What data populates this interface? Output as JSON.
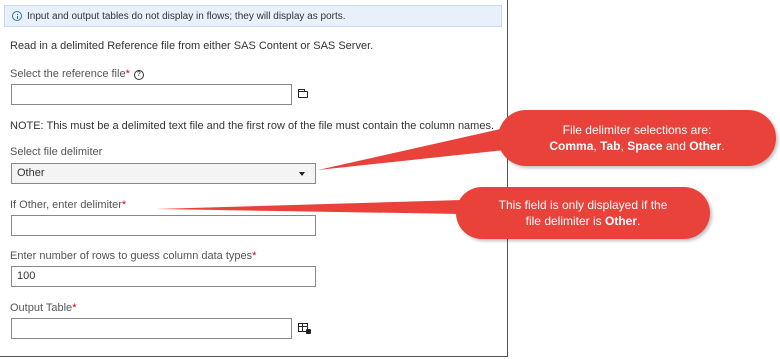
{
  "info_bar": {
    "text": "Input and output tables do not display in flows; they will display as ports."
  },
  "description": "Read in a delimited Reference file from either SAS Content or SAS Server.",
  "reference_file": {
    "label": "Select the reference file",
    "required": "*",
    "value": ""
  },
  "note": "NOTE: This must be a delimited text file and the first row of the file must contain the column names.",
  "file_delimiter": {
    "label": "Select file delimiter",
    "selected": "Other"
  },
  "other_delimiter": {
    "label": "If Other, enter delimiter",
    "required": "*",
    "value": ""
  },
  "rows_to_guess": {
    "label": "Enter number of rows to guess column data types",
    "required": "*",
    "value": "100"
  },
  "output_table": {
    "label": "Output Table",
    "required": "*",
    "value": ""
  },
  "callouts": {
    "delimiter": {
      "line1": "File delimiter selections are:",
      "comma": "Comma",
      "sep1": ", ",
      "tab": "Tab",
      "sep2": ", ",
      "space": "Space",
      "and": " and ",
      "other": "Other",
      "end": "."
    },
    "other_field": {
      "line1": "This field is only displayed if the",
      "line2_prefix": "file delimiter is ",
      "other": "Other",
      "end": "."
    }
  },
  "colors": {
    "callout": "#e8423a",
    "required": "#d0021b",
    "info_bg": "#e8f1fb",
    "info_icon": "#2a6ebb"
  },
  "icons": [
    "info-icon",
    "help-icon",
    "folder-icon",
    "table-icon",
    "chevron-down-icon"
  ]
}
